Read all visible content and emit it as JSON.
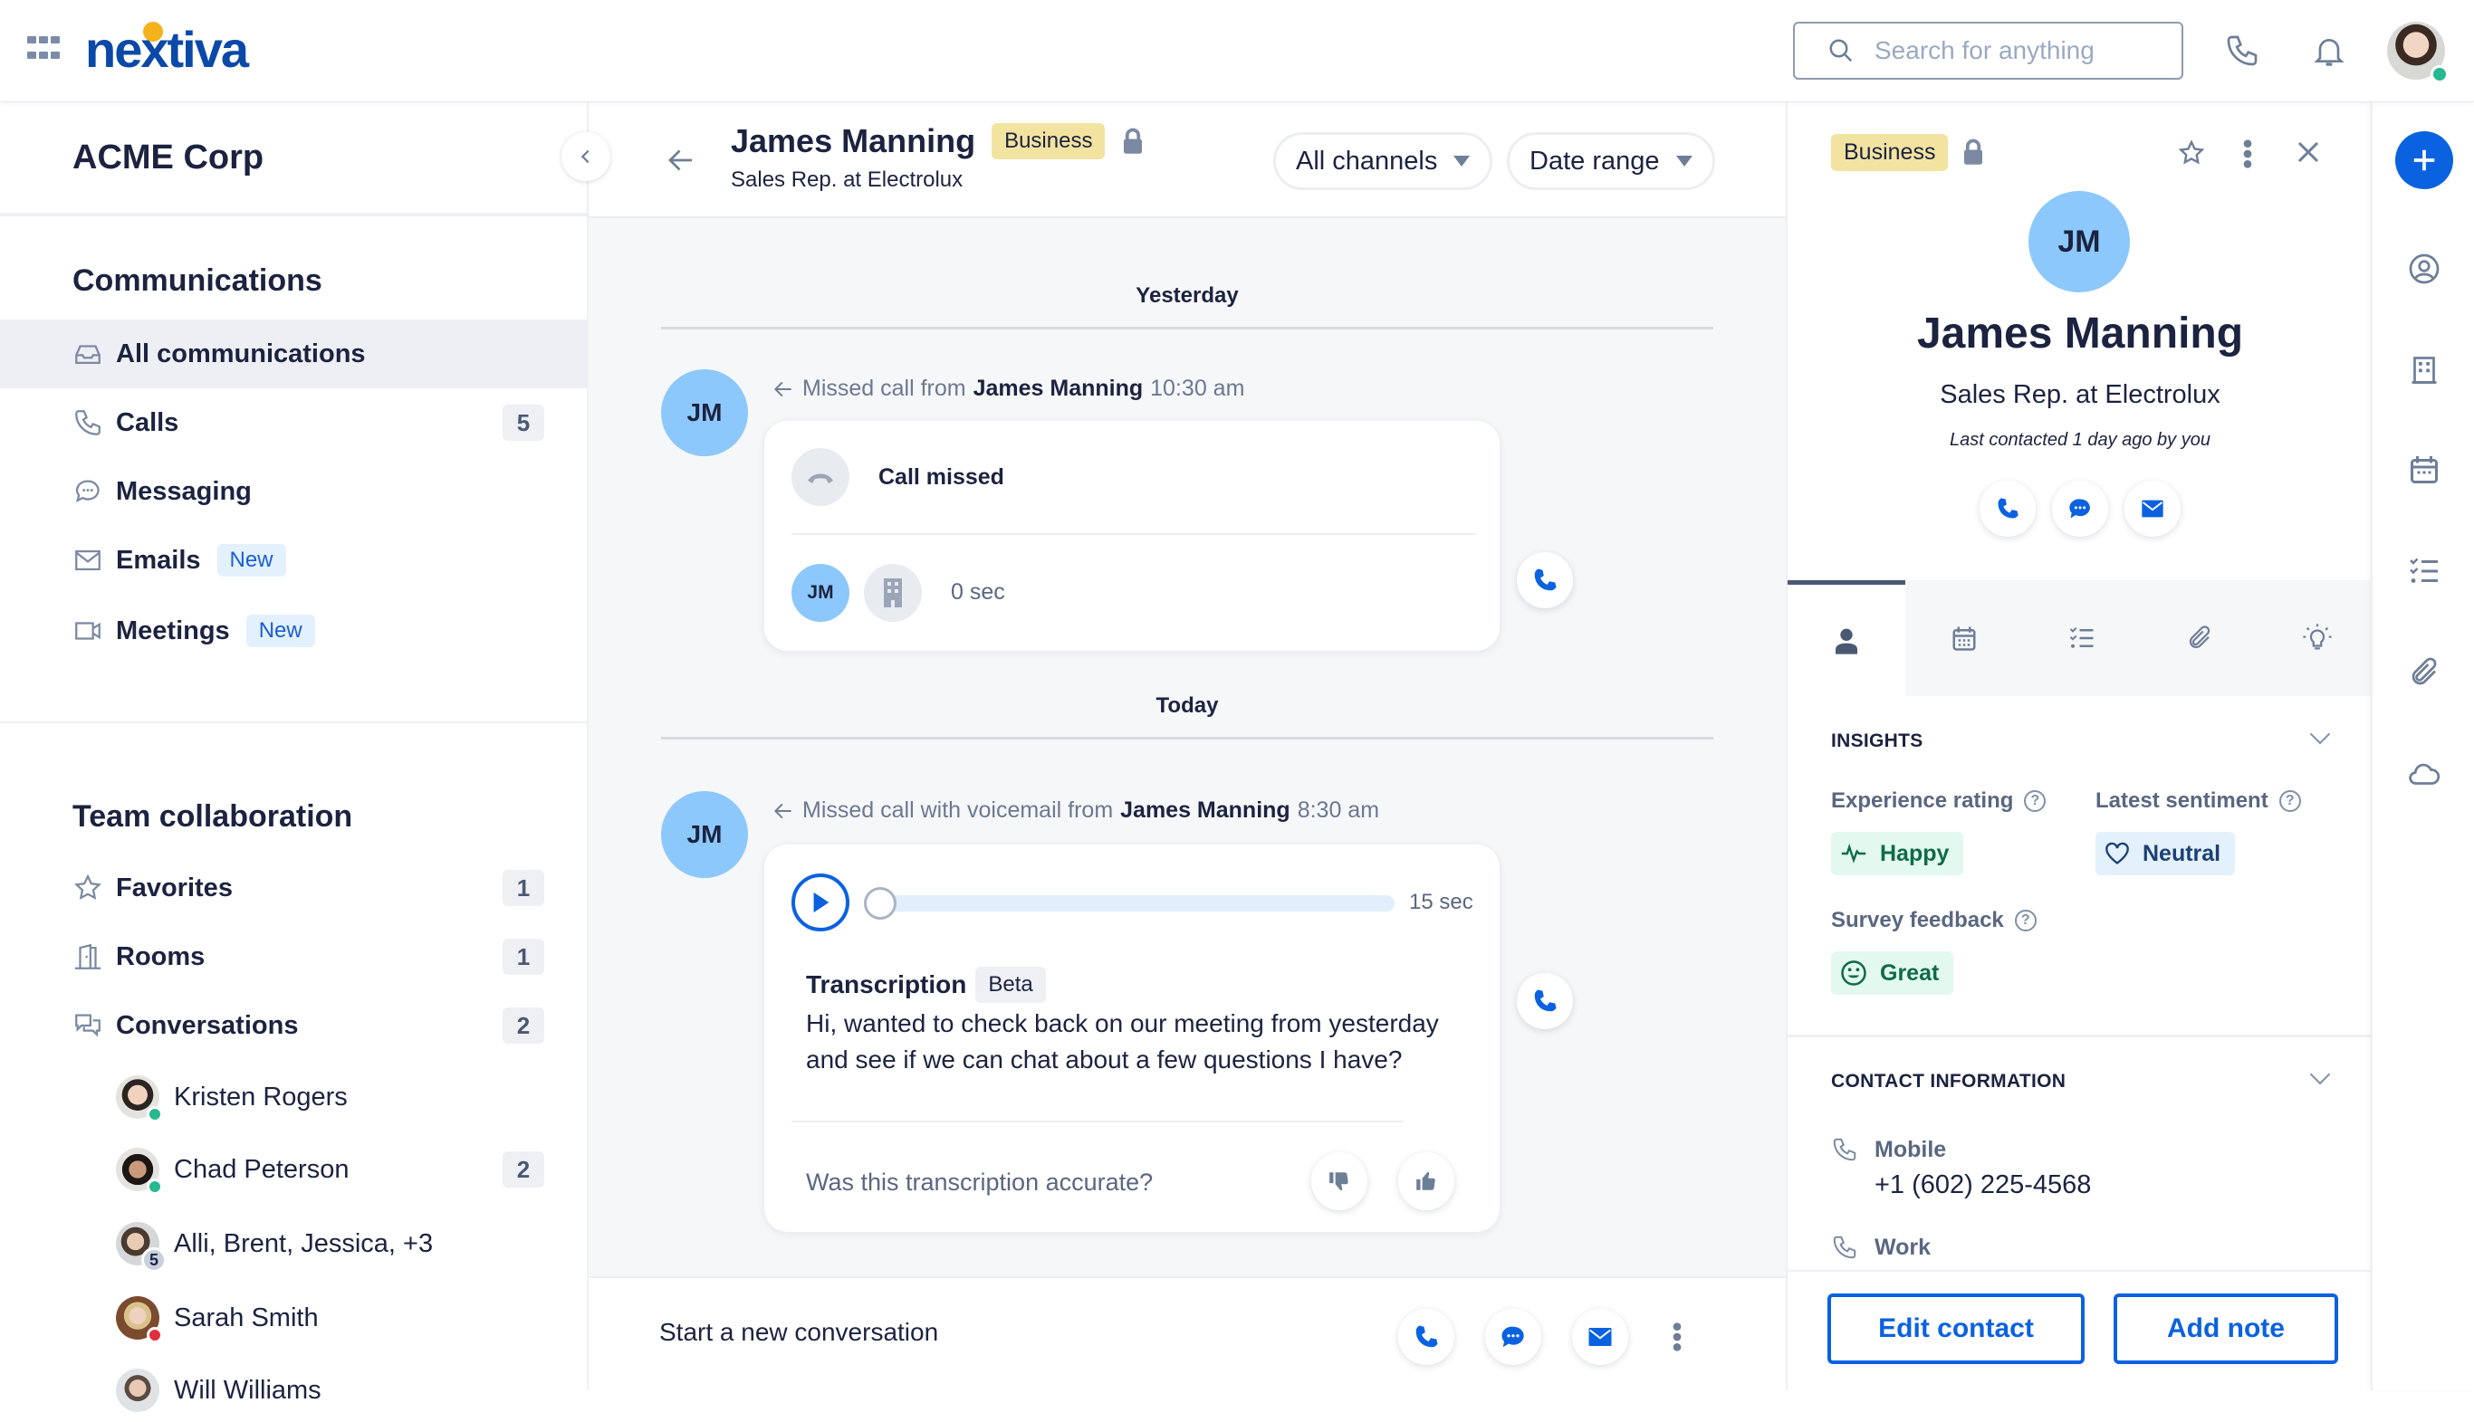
{
  "header": {
    "logo_text": "nextiva",
    "search_placeholder": "Search for anything"
  },
  "sidebar": {
    "org_name": "ACME Corp",
    "communications": {
      "title": "Communications",
      "items": [
        {
          "label": "All communications",
          "icon": "inbox-icon",
          "active": true
        },
        {
          "label": "Calls",
          "icon": "phone-icon",
          "count": "5"
        },
        {
          "label": "Messaging",
          "icon": "chat-bubble-icon"
        },
        {
          "label": "Emails",
          "icon": "envelope-icon",
          "tag": "New"
        },
        {
          "label": "Meetings",
          "icon": "video-camera-icon",
          "tag": "New"
        }
      ]
    },
    "team": {
      "title": "Team collaboration",
      "items": [
        {
          "label": "Favorites",
          "icon": "star-icon",
          "count": "1"
        },
        {
          "label": "Rooms",
          "icon": "door-icon",
          "count": "1"
        },
        {
          "label": "Conversations",
          "icon": "conversations-icon",
          "count": "2"
        }
      ],
      "conversations": [
        {
          "name": "Kristen Rogers",
          "status": "online"
        },
        {
          "name": "Chad Peterson",
          "status": "online",
          "count": "2"
        },
        {
          "name": "Alli, Brent, Jessica, +3",
          "group_count": "5"
        },
        {
          "name": "Sarah Smith",
          "status": "busy"
        },
        {
          "name": "Will Williams"
        }
      ]
    }
  },
  "conversation": {
    "contact_name": "James Manning",
    "contact_tag": "Business",
    "contact_title": "Sales Rep. at Electrolux",
    "filters": {
      "channels": "All channels",
      "date": "Date range"
    },
    "groups": [
      {
        "date": "Yesterday",
        "event": {
          "initials": "JM",
          "prefix": "Missed call from",
          "name": "James Manning",
          "time": "10:30 am",
          "status": "Call missed",
          "participant_initials": "JM",
          "duration": "0 sec"
        }
      },
      {
        "date": "Today",
        "event": {
          "initials": "JM",
          "prefix": "Missed call with voicemail from",
          "name": "James Manning",
          "time": "8:30 am",
          "voicemail_duration": "15 sec",
          "playback_progress": 0,
          "transcription_title": "Transcription",
          "transcription_tag": "Beta",
          "transcription_text": "Hi, wanted to check back on our meeting from yesterday and see if we can chat about a few questions I have?",
          "feedback_question": "Was this transcription accurate?"
        }
      }
    ],
    "composer_placeholder": "Start a new conversation"
  },
  "contact_panel": {
    "tag": "Business",
    "initials": "JM",
    "name": "James Manning",
    "title": "Sales Rep. at Electrolux",
    "last_contacted": "Last contacted 1 day ago by you",
    "tabs": [
      "person-icon",
      "calendar-icon",
      "checklist-icon",
      "paperclip-icon",
      "lightbulb-icon"
    ],
    "insights": {
      "title": "INSIGHTS",
      "experience_label": "Experience rating",
      "experience_value": "Happy",
      "sentiment_label": "Latest sentiment",
      "sentiment_value": "Neutral",
      "survey_label": "Survey feedback",
      "survey_value": "Great"
    },
    "contact_info": {
      "title": "CONTACT INFORMATION",
      "mobile_label": "Mobile",
      "mobile_value": "+1 (602) 225-4568",
      "work_label": "Work"
    },
    "edit_button": "Edit contact",
    "note_button": "Add note"
  },
  "colors": {
    "brand": "#0b49a8",
    "accent": "#0b62e0",
    "avatar": "#8cc8fb",
    "business_tag": "#f3e3a0",
    "online": "#28b88f",
    "busy": "#e0303f"
  }
}
